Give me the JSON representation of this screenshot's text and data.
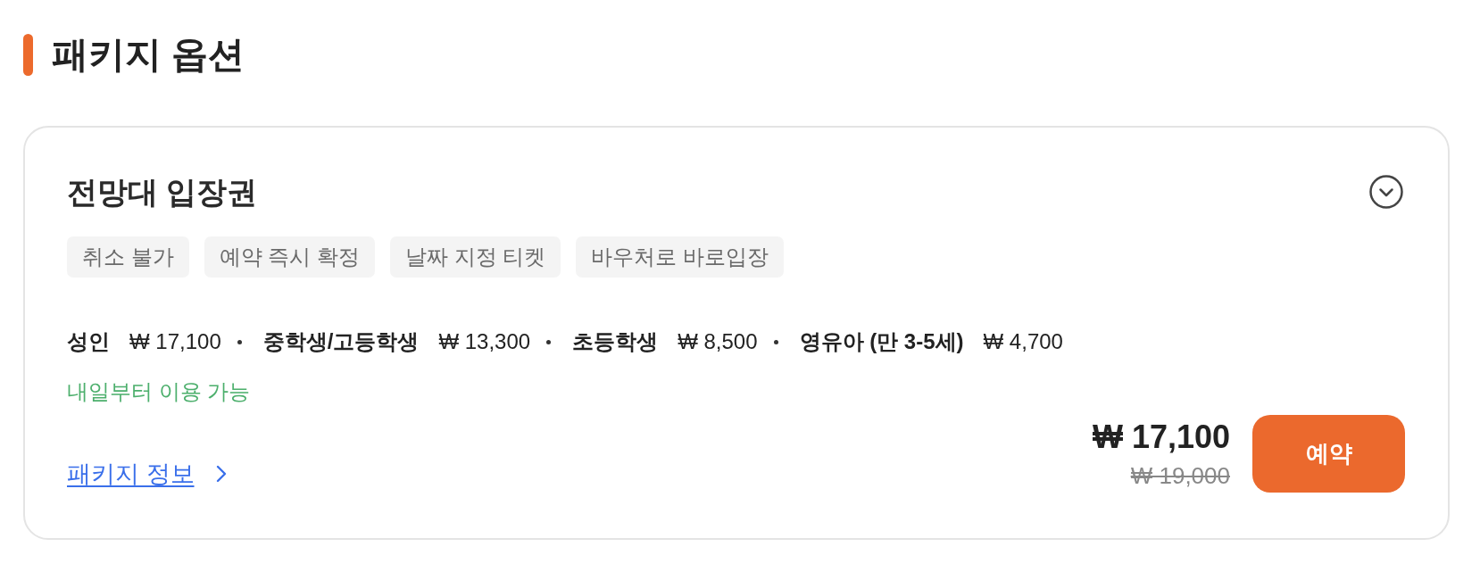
{
  "section": {
    "title": "패키지 옵션"
  },
  "package": {
    "name": "전망대 입장권",
    "expanded": false,
    "tags": [
      "취소 불가",
      "예약 즉시 확정",
      "날짜 지정 티켓",
      "바우처로 바로입장"
    ],
    "prices": [
      {
        "label": "성인",
        "price": "₩ 17,100"
      },
      {
        "label": "중학생/고등학생",
        "price": "₩ 13,300"
      },
      {
        "label": "초등학생",
        "price": "₩ 8,500"
      },
      {
        "label": "영유아 (만 3-5세)",
        "price": "₩ 4,700"
      }
    ],
    "availability": "내일부터 이용 가능",
    "info_link": "패키지 정보",
    "price": "₩ 17,100",
    "original_price": "₩ 19,000",
    "book_button": "예약"
  }
}
